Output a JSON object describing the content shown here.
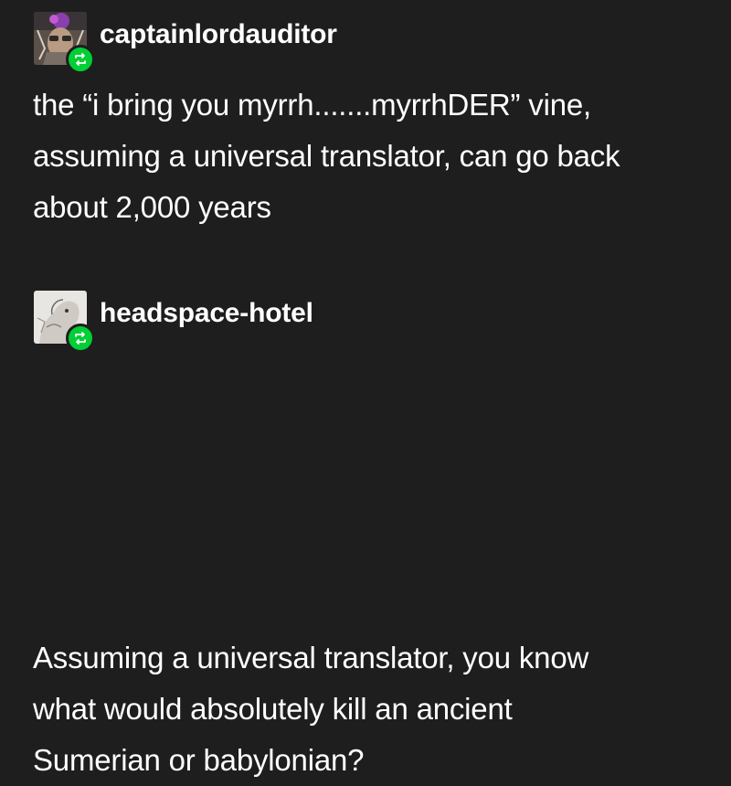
{
  "posts": [
    {
      "username": "captainlordauditor",
      "avatar_icon": "avatar-icon",
      "badge_icon": "reblog-icon",
      "badge_color": "#00cf35",
      "lines": [
        "the “i bring you myrrh.......myrrhDER” vine,",
        "assuming a universal translator, can go back",
        "about 2,000 years"
      ]
    },
    {
      "username": "headspace-hotel",
      "avatar_icon": "avatar-icon",
      "badge_icon": "reblog-icon",
      "badge_color": "#00cf35",
      "lines": [
        "Assuming a universal translator, you know",
        "what would absolutely kill an ancient",
        "Sumerian or babylonian?"
      ]
    }
  ],
  "colors": {
    "background": "#1f1e1e",
    "text": "#ffffff",
    "reblog_badge": "#00cf35"
  }
}
